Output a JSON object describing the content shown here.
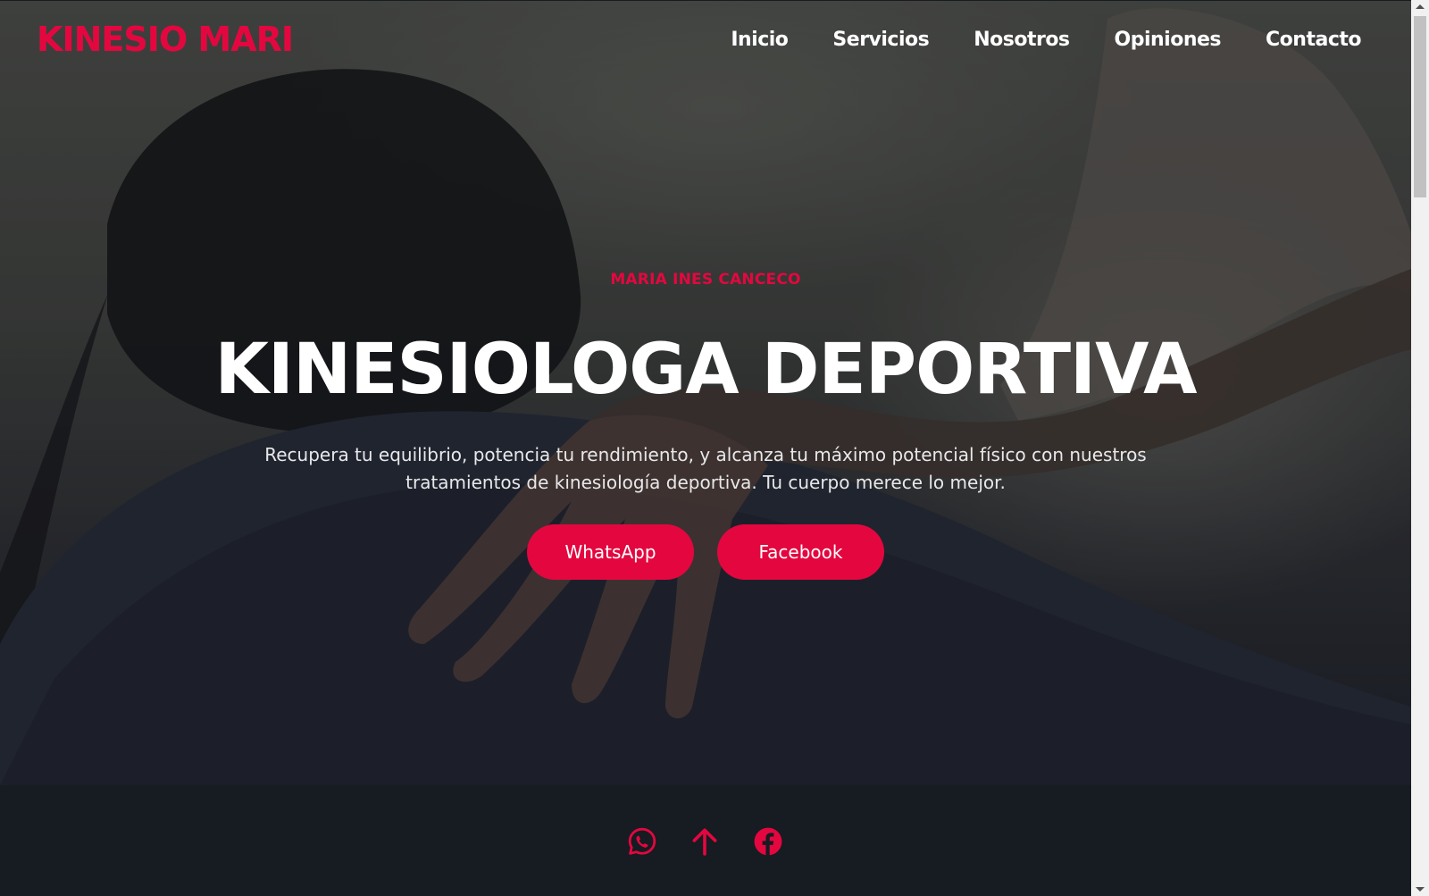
{
  "brand": {
    "logo": "KINESIO MARI",
    "accent_color": "#e4073f"
  },
  "nav": {
    "items": [
      {
        "label": "Inicio"
      },
      {
        "label": "Servicios"
      },
      {
        "label": "Nosotros"
      },
      {
        "label": "Opiniones"
      },
      {
        "label": "Contacto"
      }
    ]
  },
  "hero": {
    "kicker": "MARIA INES CANCECO",
    "title": "KINESIOLOGA DEPORTIVA",
    "description": "Recupera tu equilibrio, potencia tu rendimiento, y alcanza tu máximo potencial físico con nuestros tratamientos de kinesiología deportiva. Tu cuerpo merece lo mejor.",
    "buttons": {
      "whatsapp": "WhatsApp",
      "facebook": "Facebook"
    },
    "background_image": "woman-receiving-shoulder-massage"
  },
  "footer": {
    "icons": [
      "whatsapp-icon",
      "arrow-up-icon",
      "facebook-icon"
    ],
    "background_color": "#171b22"
  }
}
